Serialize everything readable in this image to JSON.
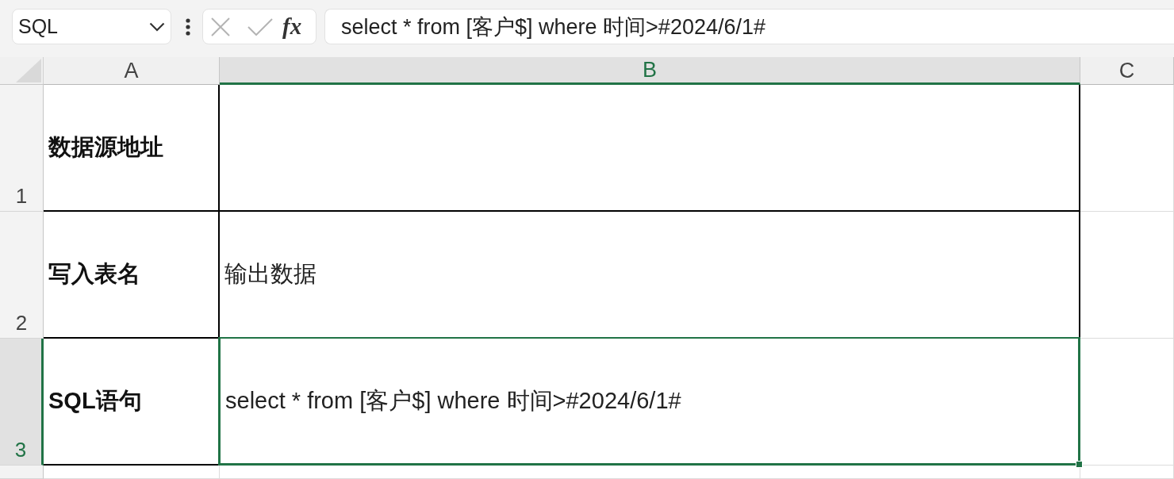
{
  "name_box": {
    "value": "SQL"
  },
  "formula_buttons": {
    "disabled": true,
    "function_label": "fx"
  },
  "formula_bar": {
    "value": "select * from [客户$] where 时间>#2024/6/1#"
  },
  "columns": [
    {
      "label": "A",
      "selected": false
    },
    {
      "label": "B",
      "selected": true
    },
    {
      "label": "C",
      "selected": false
    }
  ],
  "rows": [
    {
      "number": "1",
      "selected": false,
      "cell_a": "数据源地址"
    },
    {
      "number": "2",
      "selected": false,
      "cell_a": "写入表名",
      "cell_b": "输出数据"
    },
    {
      "number": "3",
      "selected": true,
      "cell_a": "SQL语句",
      "cell_b": "select * from [客户$] where 时间>#2024/6/1#"
    }
  ]
}
